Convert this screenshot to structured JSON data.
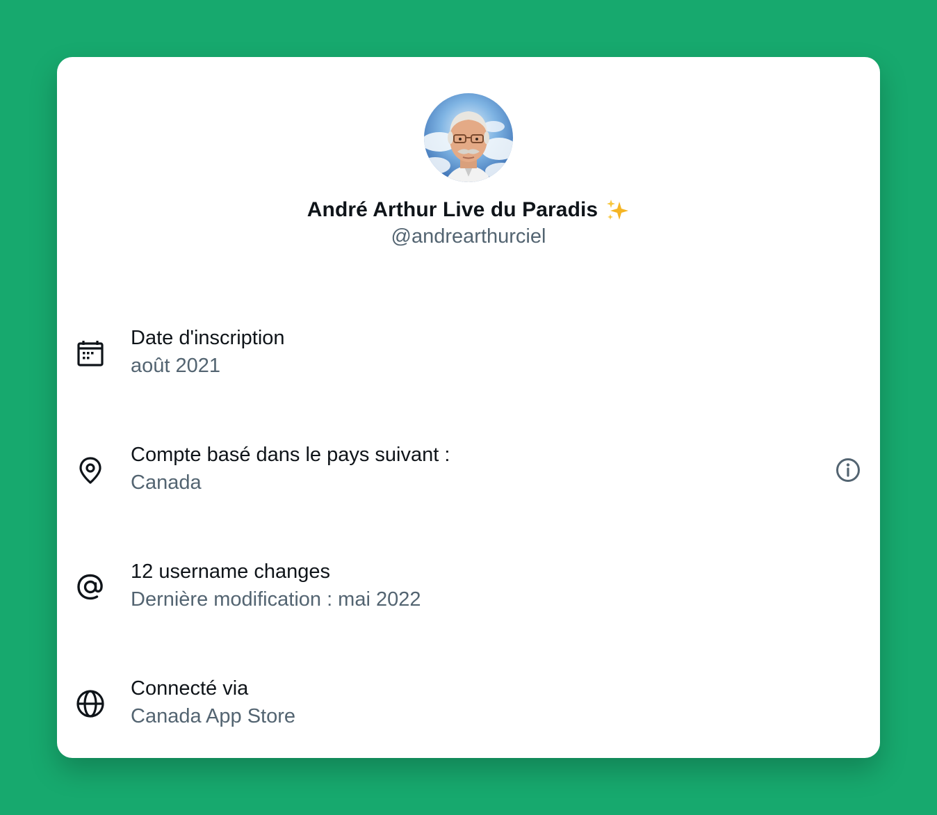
{
  "profile": {
    "display_name": "André Arthur Live du Paradis",
    "name_emoji": "sparkles-emoji",
    "handle": "@andrearthurciel",
    "avatar_alt": "avatar"
  },
  "rows": [
    {
      "icon": "calendar-icon",
      "label": "Date d'inscription",
      "value": "août 2021"
    },
    {
      "icon": "location-pin-icon",
      "label": "Compte basé dans le pays suivant :",
      "value": "Canada",
      "trailing_icon": "info-icon"
    },
    {
      "icon": "at-sign-icon",
      "label": "12 username changes",
      "value": "Dernière modification : mai 2022"
    },
    {
      "icon": "globe-icon",
      "label": "Connecté via",
      "value": "Canada App Store"
    }
  ],
  "colors": {
    "background": "#17a96e",
    "card": "#ffffff",
    "primary_text": "#0f1419",
    "secondary_text": "#536471",
    "sparkle": "#f5b524"
  }
}
